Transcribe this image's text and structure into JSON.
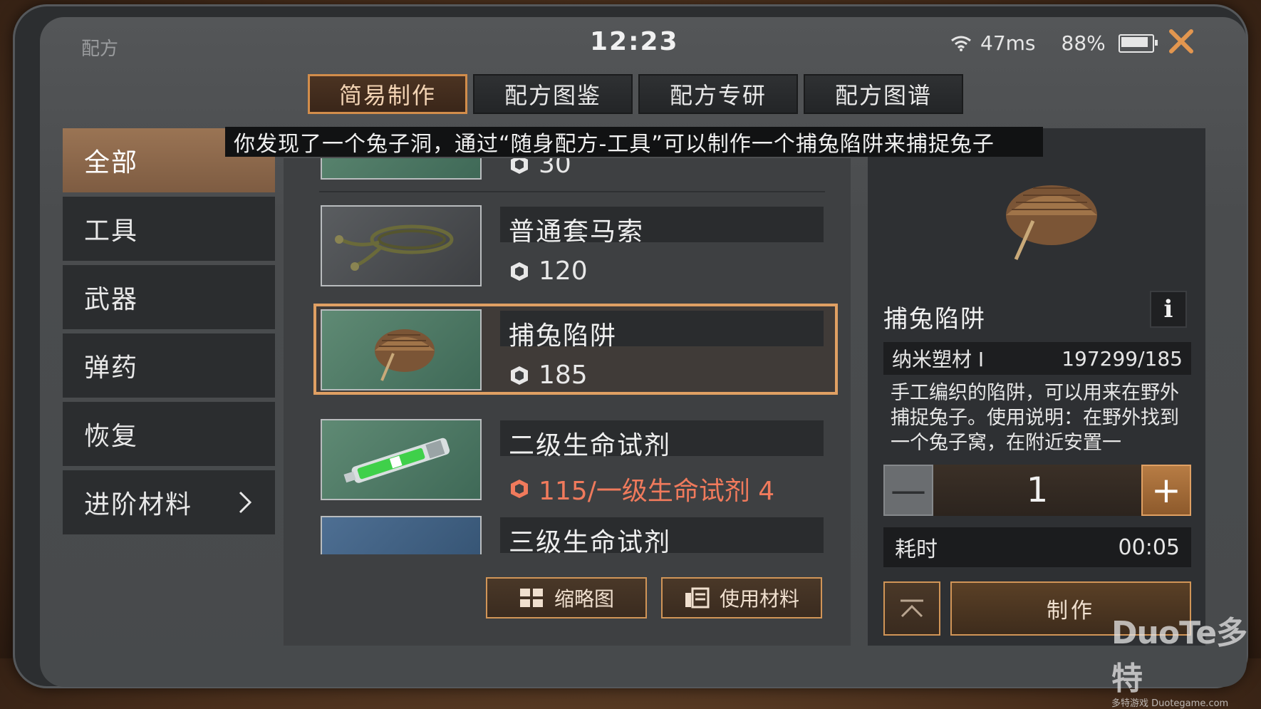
{
  "status_bar": {
    "title": "配方",
    "time": "12:23",
    "ping": "47ms",
    "battery": "88%",
    "battery_level": 0.88
  },
  "tabs": [
    {
      "label": "简易制作",
      "active": true
    },
    {
      "label": "配方图鉴",
      "active": false
    },
    {
      "label": "配方专研",
      "active": false
    },
    {
      "label": "配方图谱",
      "active": false
    }
  ],
  "categories": [
    {
      "label": "全部",
      "active": true
    },
    {
      "label": "工具",
      "active": false
    },
    {
      "label": "武器",
      "active": false
    },
    {
      "label": "弹药",
      "active": false
    },
    {
      "label": "恢复",
      "active": false
    },
    {
      "label": "进阶材料",
      "active": false
    }
  ],
  "tooltip": "你发现了一个兔子洞，通过“随身配方-工具”可以制作一个捕兔陷阱来捕捉兔子",
  "items": [
    {
      "name": "",
      "cost": "30"
    },
    {
      "name": "普通套马索",
      "cost": "120"
    },
    {
      "name": "捕兔陷阱",
      "cost": "185",
      "selected": true
    },
    {
      "name": "二级生命试剂",
      "cost": "115/一级生命试剂 4",
      "insufficient": true
    },
    {
      "name": "三级生命试剂",
      "cost": ""
    }
  ],
  "list_buttons": {
    "thumbnail": "缩略图",
    "use_materials": "使用材料"
  },
  "detail": {
    "name": "捕兔陷阱",
    "info_label": "i",
    "material_name": "纳米塑材 I",
    "material_count": "197299/185",
    "description": "手工编织的陷阱，可以用来在野外捕捉兔子。使用说明：在野外找到一个兔子窝，在附近安置一",
    "quantity": "1",
    "minus_label": "—",
    "plus_label": "+",
    "time_label": "耗时",
    "time_value": "00:05",
    "craft_label": "制作"
  },
  "watermark": {
    "brand": "DuoTe多特",
    "site": "多特游戏 Duotegame.com"
  },
  "colors": {
    "accent": "#d28d4b",
    "selected_border": "#e0a063",
    "insufficient": "#f07a5c",
    "cat_active": "#8b6a4e"
  }
}
